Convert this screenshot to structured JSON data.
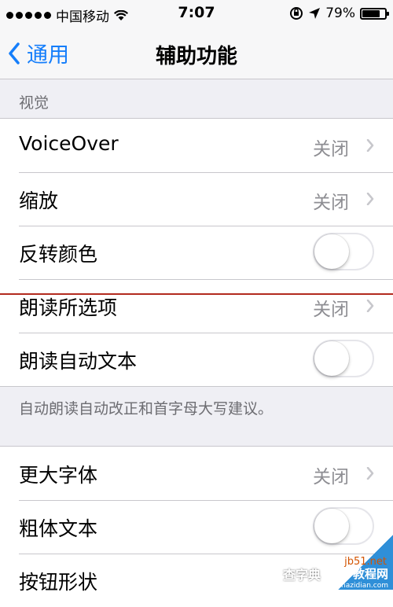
{
  "status_bar": {
    "carrier": "中国移动",
    "time": "7:07",
    "battery_percent": "79%",
    "battery_level": 0.79,
    "icons": [
      "signal-dots-icon",
      "wifi-icon",
      "orientation-lock-icon",
      "location-arrow-icon",
      "battery-icon"
    ]
  },
  "nav": {
    "back_label": "通用",
    "title": "辅助功能"
  },
  "sections": {
    "vision_header": "视觉",
    "speak_footer": "自动朗读自动改正和首字母大写建议。"
  },
  "rows": {
    "voiceover": {
      "label": "VoiceOver",
      "value": "关闭"
    },
    "zoom": {
      "label": "缩放",
      "value": "关闭"
    },
    "invert_colors": {
      "label": "反转颜色",
      "toggle": false
    },
    "speak_selection": {
      "label": "朗读所选项",
      "value": "关闭"
    },
    "speak_auto_text": {
      "label": "朗读自动文本",
      "toggle": false
    },
    "larger_type": {
      "label": "更大字体",
      "value": "关闭"
    },
    "bold_text": {
      "label": "粗体文本",
      "toggle": false
    },
    "button_shapes": {
      "label": "按钮形状"
    }
  },
  "watermark": {
    "site": "jb51.net",
    "cn": "教程网",
    "url": "jiaocheng.chazidian.com",
    "left": "查字典"
  },
  "colors": {
    "accent": "#157efb",
    "background": "#efeff4",
    "secondary_text": "#8e8e93",
    "annotation_line": "#b22a1e"
  }
}
